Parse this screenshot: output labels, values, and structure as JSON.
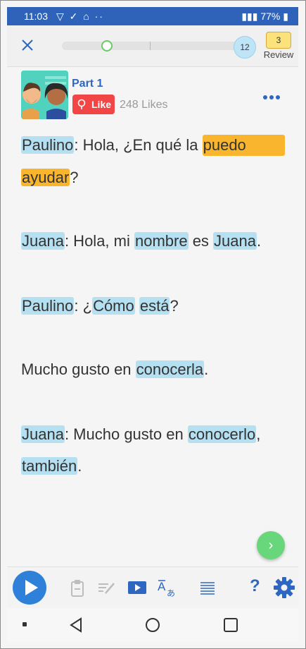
{
  "status_bar": {
    "time": "11:03",
    "battery": "77%"
  },
  "top_bar": {
    "progress_fraction": 0.25,
    "count_badge": "12",
    "review_count": "3",
    "review_label": "Review"
  },
  "lesson": {
    "part_title": "Part 1",
    "like_label": "Like",
    "likes_count": "248 Likes"
  },
  "dialogue": [
    [
      {
        "t": "Paulino",
        "h": "blue"
      },
      {
        "t": ": Hola, ¿En qué la "
      },
      {
        "t": "puedo",
        "h": "yellow"
      }
    ],
    [
      {
        "t": "ayudar",
        "h": "yellow"
      },
      {
        "t": "?"
      }
    ],
    [
      {
        "t": "Juana",
        "h": "blue"
      },
      {
        "t": ": Hola, mi "
      },
      {
        "t": "nombre",
        "h": "blue"
      },
      {
        "t": " es "
      },
      {
        "t": "Juana",
        "h": "blue"
      },
      {
        "t": "."
      }
    ],
    [
      {
        "t": "Paulino",
        "h": "blue"
      },
      {
        "t": ": ¿"
      },
      {
        "t": "Cómo",
        "h": "blue"
      },
      {
        "t": " "
      },
      {
        "t": "está",
        "h": "blue"
      },
      {
        "t": "?"
      }
    ],
    [
      {
        "t": "Mucho gusto en "
      },
      {
        "t": "conocerla",
        "h": "blue"
      },
      {
        "t": "."
      }
    ],
    [
      {
        "t": "Juana",
        "h": "blue"
      },
      {
        "t": ": Mucho gusto en "
      },
      {
        "t": "conocerlo",
        "h": "blue"
      },
      {
        "t": ","
      }
    ],
    [
      {
        "t": "también",
        "h": "blue"
      },
      {
        "t": "."
      }
    ]
  ],
  "toolbar": {
    "icons": [
      "play-icon",
      "clipboard-icon",
      "edit-lines-icon",
      "video-play-icon",
      "translate-icon",
      "list-icon",
      "help-icon",
      "gear-icon"
    ],
    "help_label": "?"
  },
  "colors": {
    "accent": "#2e67c2",
    "highlight_blue": "#b4e0f2",
    "highlight_yellow": "#f8b52d",
    "like_red": "#f24646",
    "next_green": "#68d67a"
  }
}
